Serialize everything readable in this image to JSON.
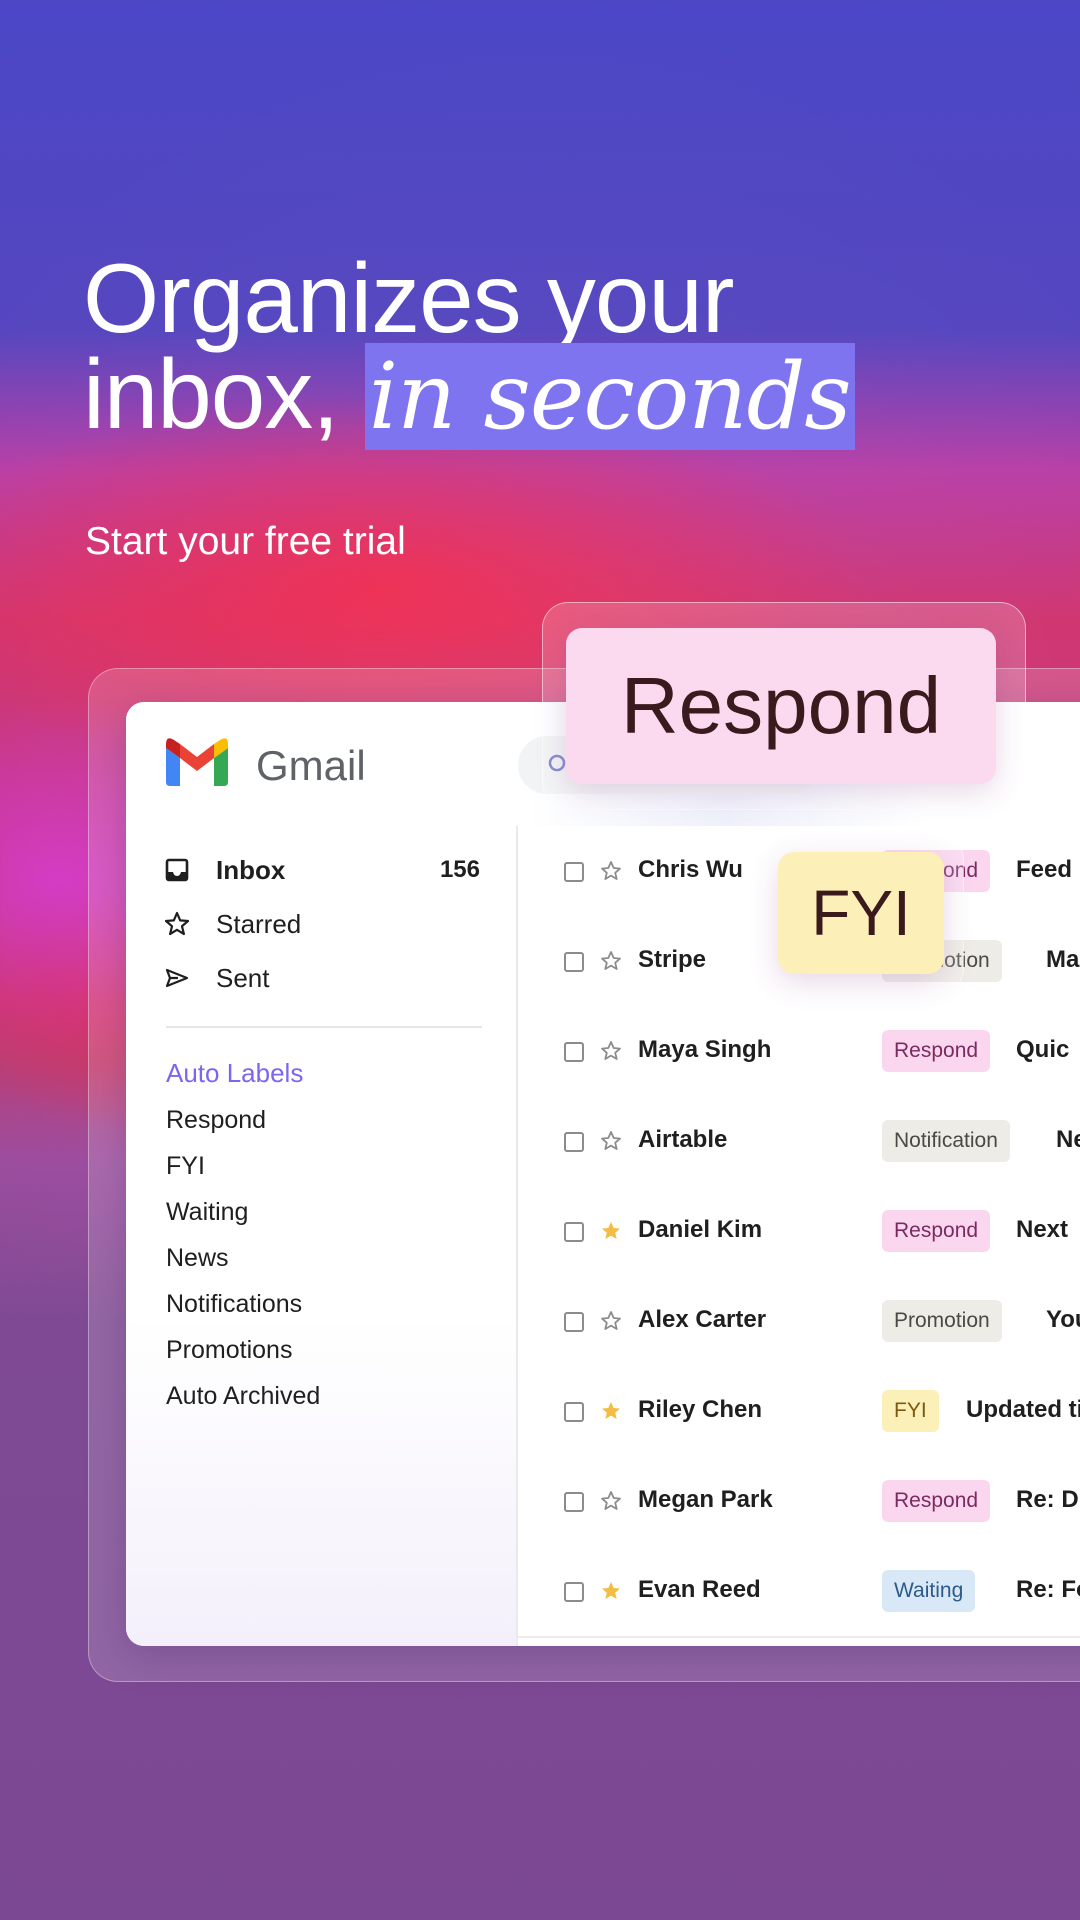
{
  "hero": {
    "headline_line1": "Organizes your",
    "headline_line2_plain": "inbox,",
    "headline_line2_highlight": "in seconds",
    "subhead": "Start your free trial"
  },
  "app": {
    "brand": "Gmail",
    "nav": [
      {
        "label": "Inbox",
        "count": "156",
        "icon": "inbox-icon"
      },
      {
        "label": "Starred",
        "count": "",
        "icon": "star-icon"
      },
      {
        "label": "Sent",
        "count": "",
        "icon": "send-icon"
      }
    ],
    "labels_title": "Auto Labels",
    "labels": [
      "Respond",
      "FYI",
      "Waiting",
      "News",
      "Notifications",
      "Promotions",
      "Auto Archived"
    ],
    "rows": [
      {
        "sender": "Chris Wu",
        "tag": "Respond",
        "tag_type": "respond",
        "subject": "Feed",
        "starred": false
      },
      {
        "sender": "Stripe",
        "tag": "Promotion",
        "tag_type": "promotion",
        "subject": "Ma",
        "starred": false
      },
      {
        "sender": "Maya Singh",
        "tag": "Respond",
        "tag_type": "respond",
        "subject": "Quic",
        "starred": false
      },
      {
        "sender": "Airtable",
        "tag": "Notification",
        "tag_type": "notification",
        "subject": "Ne",
        "starred": false
      },
      {
        "sender": "Daniel Kim",
        "tag": "Respond",
        "tag_type": "respond",
        "subject": "Next",
        "starred": true
      },
      {
        "sender": "Alex Carter",
        "tag": "Promotion",
        "tag_type": "promotion",
        "subject": "You",
        "starred": false
      },
      {
        "sender": "Riley Chen",
        "tag": "FYI",
        "tag_type": "fyi",
        "subject": "Updated ti",
        "starred": true
      },
      {
        "sender": "Megan Park",
        "tag": "Respond",
        "tag_type": "respond",
        "subject": "Re: D",
        "starred": false
      },
      {
        "sender": "Evan Reed",
        "tag": "Waiting",
        "tag_type": "waiting",
        "subject": "Re: Fo",
        "starred": true
      }
    ]
  },
  "chips": {
    "respond": "Respond",
    "fyi": "FYI"
  },
  "colors": {
    "accent_purple": "#7e74ef",
    "star_gold": "#f2bd42",
    "gmail_red": "#ea4335",
    "gmail_blue": "#4285f4",
    "gmail_green": "#34a853",
    "gmail_yellow": "#fbbc04"
  }
}
